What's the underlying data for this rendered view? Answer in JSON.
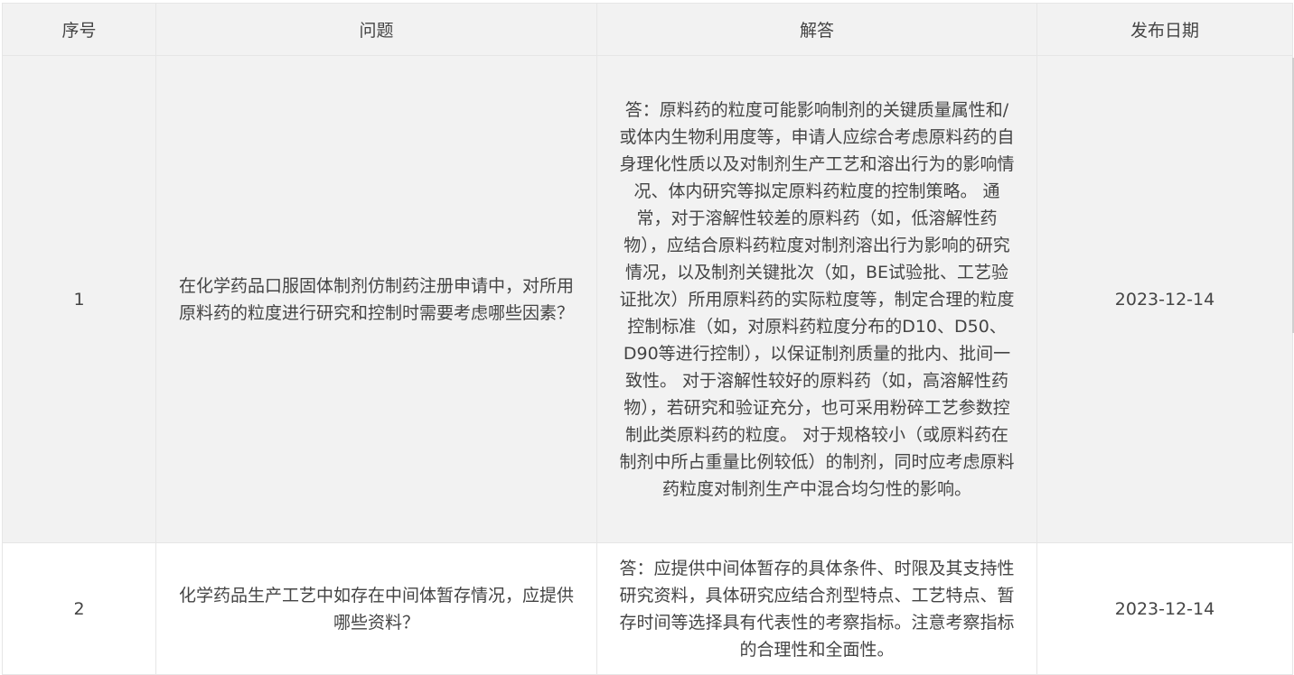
{
  "table": {
    "headers": {
      "seq": "序号",
      "question": "问题",
      "answer": "解答",
      "date": "发布日期"
    },
    "rows": [
      {
        "seq": "1",
        "question": "在化学药品口服固体制剂仿制药注册申请中，对所用原料药的粒度进行研究和控制时需要考虑哪些因素？",
        "answer": "答：原料药的粒度可能影响制剂的关键质量属性和/或体内生物利用度等，申请人应综合考虑原料药的自身理化性质以及对制剂生产工艺和溶出行为的影响情况、体内研究等拟定原料药粒度的控制策略。 通常，对于溶解性较差的原料药（如，低溶解性药物），应结合原料药粒度对制剂溶出行为影响的研究情况，以及制剂关键批次（如，BE试验批、工艺验证批次）所用原料药的实际粒度等，制定合理的粒度控制标准（如，对原料药粒度分布的D10、D50、D90等进行控制），以保证制剂质量的批内、批间一致性。 对于溶解性较好的原料药（如，高溶解性药物），若研究和验证充分，也可采用粉碎工艺参数控制此类原料药的粒度。 对于规格较小（或原料药在制剂中所占重量比例较低）的制剂，同时应考虑原料药粒度对制剂生产中混合均匀性的影响。",
        "date": "2023-12-14"
      },
      {
        "seq": "2",
        "question": "化学药品生产工艺中如存在中间体暂存情况，应提供哪些资料？",
        "answer": "答：应提供中间体暂存的具体条件、时限及其支持性研究资料，具体研究应结合剂型特点、工艺特点、暂存时间等选择具有代表性的考察指标。注意考察指标的合理性和全面性。",
        "date": "2023-12-14"
      }
    ]
  }
}
